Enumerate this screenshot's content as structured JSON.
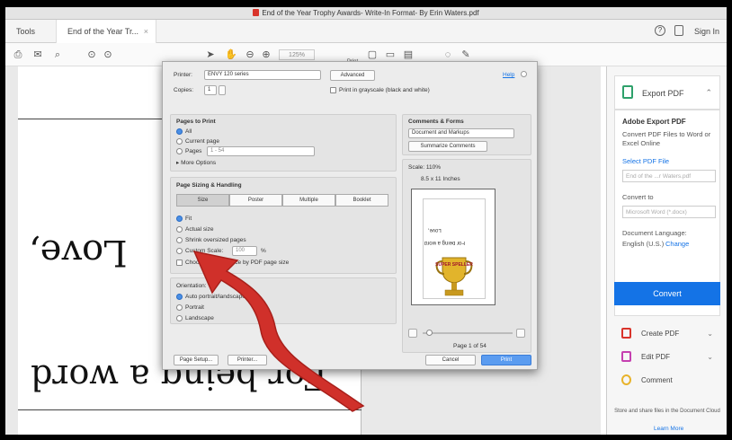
{
  "window": {
    "title": "End of the Year Trophy Awards- Write-In Format- By Erin Waters.pdf"
  },
  "tabs": {
    "tools": "Tools",
    "doc_tab": "End of the Year Tr...",
    "close": "×",
    "signin": "Sign In"
  },
  "toolbar": {
    "print_label": "Print",
    "zoom": "125%"
  },
  "document": {
    "text1": "Love,",
    "text2": "For being a word"
  },
  "dialog": {
    "printer_label": "Printer:",
    "printer_value": "ENVY 120 series",
    "advanced_label": "Advanced",
    "help_label": "Help",
    "copies_label": "Copies:",
    "copies_value": "1",
    "grayscale_label": "Print in grayscale (black and white)",
    "pages_to_print": {
      "title": "Pages to Print",
      "all": "All",
      "current": "Current page",
      "pages": "Pages",
      "pages_value": "1 - 54",
      "more": "More Options"
    },
    "sizing": {
      "title": "Page Sizing & Handling",
      "tabs": [
        "Size",
        "Poster",
        "Multiple",
        "Booklet"
      ],
      "fit": "Fit",
      "actual": "Actual size",
      "shrink": "Shrink oversized pages",
      "custom": "Custom Scale:",
      "custom_value": "100",
      "custom_unit": "%",
      "choose": "Choose paper source by PDF page size"
    },
    "orientation": {
      "title": "Orientation:",
      "auto": "Auto portrait/landscape",
      "portrait": "Portrait",
      "landscape": "Landscape"
    },
    "comments": {
      "title": "Comments & Forms",
      "select_value": "Document and Markups",
      "summarize": "Summarize Comments"
    },
    "preview": {
      "scale": "Scale: 110%",
      "paper": "8.5 x 11 Inches",
      "page_count": "Page 1 of 54",
      "line1": "Love,",
      "line2": "For being a word",
      "trophy_text": "SUPER SPELLER"
    },
    "buttons": {
      "page_setup": "Page Setup...",
      "printer": "Printer...",
      "cancel": "Cancel",
      "print": "Print"
    }
  },
  "right_panel": {
    "export_pdf": "Export PDF",
    "adobe_export": "Adobe Export PDF",
    "desc": "Convert PDF Files to Word or Excel Online",
    "select_file": "Select PDF File",
    "file_value": "End of the ...r Waters.pdf",
    "convert_to": "Convert to",
    "convert_value": "Microsoft Word (*.docx)",
    "doc_lang": "Document Language:",
    "lang_value": "English (U.S.)",
    "change": "Change",
    "convert_button": "Convert",
    "create_pdf": "Create PDF",
    "edit_pdf": "Edit PDF",
    "comment": "Comment",
    "store_text": "Store and share files in the Document Cloud",
    "learn_more": "Learn More"
  },
  "colors": {
    "accent": "#1473e6",
    "arrow": "#d0302a"
  }
}
